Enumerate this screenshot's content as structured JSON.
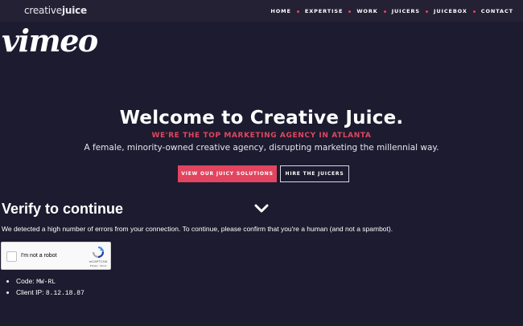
{
  "header": {
    "brand_light": "creative",
    "brand_bold": "juice",
    "nav": [
      "HOME",
      "EXPERTISE",
      "WORK",
      "JUICERS",
      "JUICEBOX",
      "CONTACT"
    ]
  },
  "vimeo_logo": "vimeo",
  "hero": {
    "title": "Welcome to Creative Juice.",
    "subtitle": "WE'RE THE TOP MARKETING AGENCY IN ATLANTA",
    "description": "A female, minority-owned creative agency, disrupting marketing the millennial way.",
    "primary_button": "VIEW OUR JUICY SOLUTIONS",
    "secondary_button": "HIRE THE JUICERS"
  },
  "verify": {
    "title": "Verify to continue",
    "message": "We detected a high number of errors from your connection. To continue, please confirm that you're a human (and not a spambot).",
    "captcha_label": "I'm not a robot",
    "captcha_brand": "reCAPTCHA",
    "captcha_links": "Privacy - Terms",
    "code_label": "Code:",
    "code_value": "MW-RL",
    "ip_label": "Client IP:",
    "ip_value": "8.12.18.87"
  },
  "colors": {
    "accent": "#e2455f",
    "background": "#1d1b2f",
    "topbar": "#232133"
  },
  "icons": [
    "chevron-down-icon",
    "recaptcha-logo-icon"
  ]
}
